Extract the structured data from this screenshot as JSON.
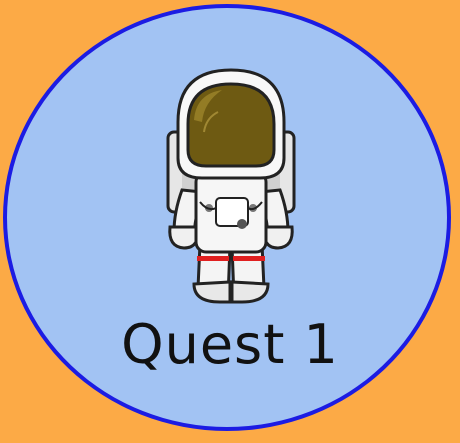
{
  "quest": {
    "title": "Quest 1",
    "character": "astronaut-icon"
  },
  "colors": {
    "background": "#FCAA46",
    "badge_fill": "#A2C3F3",
    "badge_border": "#1C1CE3"
  }
}
